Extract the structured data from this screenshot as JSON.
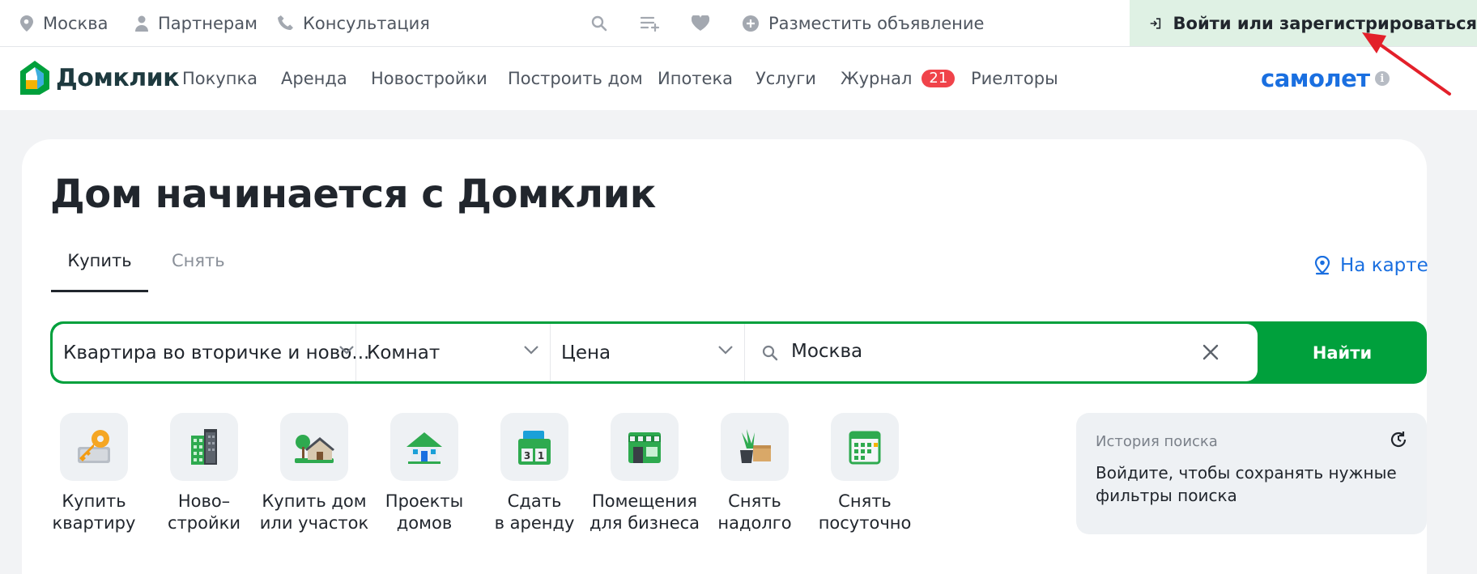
{
  "topbar": {
    "city": "Москва",
    "partners": "Партнерам",
    "consultation": "Консультация",
    "post_ad": "Разместить объявление",
    "login": "Войти или зарегистрироваться"
  },
  "logo": {
    "text": "Домклик"
  },
  "nav": {
    "items": [
      "Покупка",
      "Аренда",
      "Новостройки",
      "Построить дом",
      "Ипотека",
      "Услуги",
      "Журнал",
      "Риелторы"
    ],
    "journal_badge": "21",
    "partner_brand": "самолет"
  },
  "hero": {
    "title": "Дом начинается с Домклик"
  },
  "tabs": {
    "buy": "Купить",
    "rent": "Снять",
    "on_map": "На карте"
  },
  "search": {
    "type": "Квартира во вторичке и ново...",
    "rooms": "Комнат",
    "price": "Цена",
    "location": "Москва",
    "submit": "Найти"
  },
  "categories": [
    {
      "line1": "Купить",
      "line2": "квартиру",
      "icon": "key-icon"
    },
    {
      "line1": "Ново–",
      "line2": "стройки",
      "icon": "building-icon"
    },
    {
      "line1": "Купить дом",
      "line2": "или участок",
      "icon": "house-tree-icon"
    },
    {
      "line1": "Проекты",
      "line2": "домов",
      "icon": "house-project-icon"
    },
    {
      "line1": "Сдать",
      "line2": "в аренду",
      "icon": "calendar-box-icon"
    },
    {
      "line1": "Помещения",
      "line2": "для бизнеса",
      "icon": "shop-icon"
    },
    {
      "line1": "Снять",
      "line2": "надолго",
      "icon": "plant-box-icon"
    },
    {
      "line1": "Снять",
      "line2": "посуточно",
      "icon": "calendar-icon"
    }
  ],
  "history": {
    "title": "История поиска",
    "text": "Войдите, чтобы сохранять нужные фильтры поиска"
  },
  "colors": {
    "brand_green": "#00a03c",
    "login_bg": "#dff1e4",
    "samolet_blue": "#1a6fe0",
    "badge_red": "#f0434a",
    "annotation_arrow": "#e3202a"
  }
}
